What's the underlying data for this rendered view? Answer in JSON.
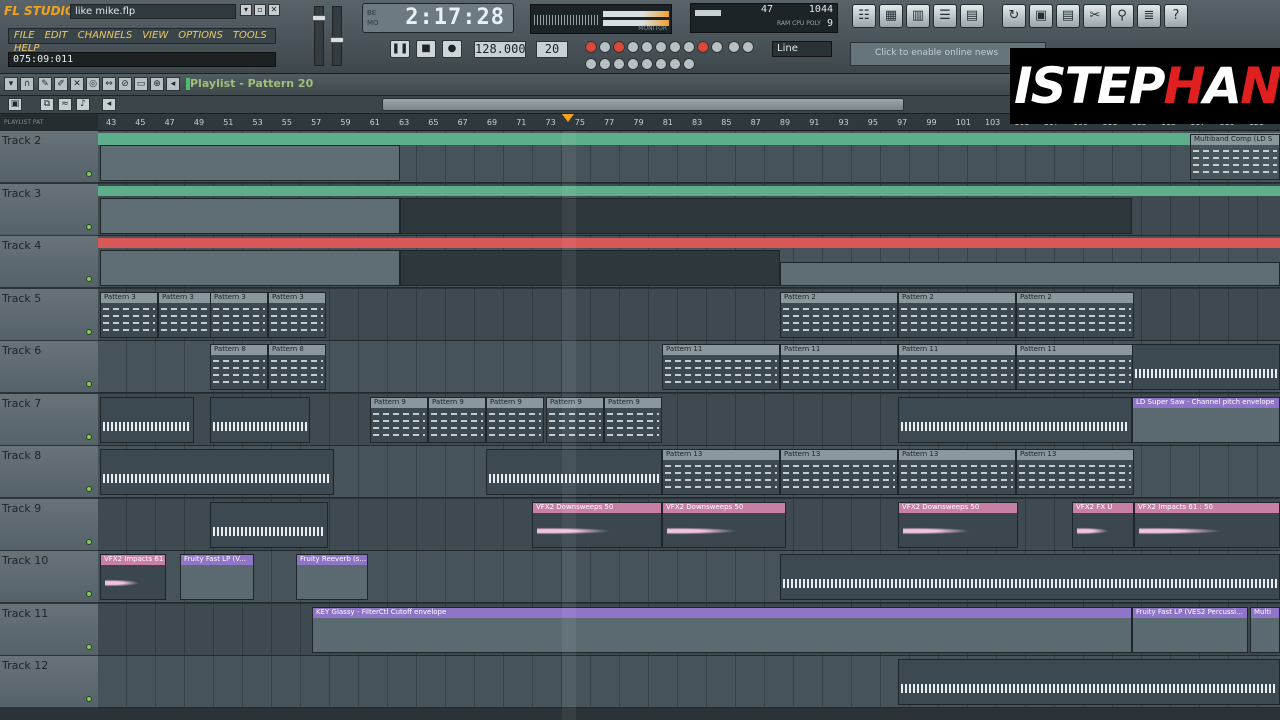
{
  "app": {
    "logo": "FL STUDIO",
    "filename": "like mike.flp",
    "menu": [
      "FILE",
      "EDIT",
      "CHANNELS",
      "VIEW",
      "OPTIONS",
      "TOOLS",
      "HELP"
    ],
    "hint": "075:09:011",
    "time": "2:17:28",
    "time_labels": [
      "BE",
      "MO"
    ],
    "tempo": "128.000",
    "pattern_number": "20",
    "snap": "Line",
    "cpu": "47",
    "ram": "1044",
    "poly": "9",
    "cpu_labels": "RAM CPU POLY",
    "monitor_label": "MONITOR",
    "news": "Click to enable online news",
    "overlay_logo": "STEPHAN"
  },
  "playlist": {
    "title": "Playlist - Pattern 20",
    "ruler_left": "PLAYLIST PAT",
    "ruler_numbers": [
      "43",
      "45",
      "47",
      "49",
      "51",
      "53",
      "55",
      "57",
      "59",
      "61",
      "63",
      "65",
      "67",
      "69",
      "71",
      "73",
      "75",
      "77",
      "79",
      "81",
      "83",
      "85",
      "87",
      "89",
      "91",
      "93",
      "95",
      "97",
      "99",
      "101",
      "103",
      "105",
      "107",
      "109",
      "111",
      "113",
      "115",
      "117",
      "119",
      "121"
    ],
    "tracks": [
      {
        "name": "Track 2"
      },
      {
        "name": "Track 3"
      },
      {
        "name": "Track 4"
      },
      {
        "name": "Track 5"
      },
      {
        "name": "Track 6"
      },
      {
        "name": "Track 7"
      },
      {
        "name": "Track 8"
      },
      {
        "name": "Track 9"
      },
      {
        "name": "Track 10"
      },
      {
        "name": "Track 11"
      },
      {
        "name": "Track 12"
      }
    ],
    "clips": {
      "t2_comp": "Multiband Comp (LD S",
      "p3": "Pattern 3",
      "p2": "Pattern 2",
      "p8": "Pattern 8",
      "p11": "Pattern 11",
      "p9": "Pattern 9",
      "p13": "Pattern 13",
      "ld_env": "LD Super Saw - Channel pitch envelope",
      "downsweeps": "VFX2 Downsweeps 50",
      "vfx_fx": "VFX2 FX U",
      "impacts61": "VFX2 Impacts 61",
      "impacts61b": "VFX2 Impacts 61 : 50",
      "fastlp": "Fruity Fast LP (V...",
      "reverb": "Fruity Reeverb (s...",
      "key_glassy": "KEY Glassy - FilterCtl Cutoff envelope",
      "fastlp_perc": "Fruity Fast LP (VES2 Percussi...",
      "multi": "Multi"
    }
  },
  "colors": {
    "accent": "#f3a21a",
    "track2_bar": "#5fae8b",
    "track3_bar": "#5fae8b",
    "track4_bar": "#d85858",
    "automation": "#8f75c8",
    "audio_clip": "#c87fa6"
  }
}
